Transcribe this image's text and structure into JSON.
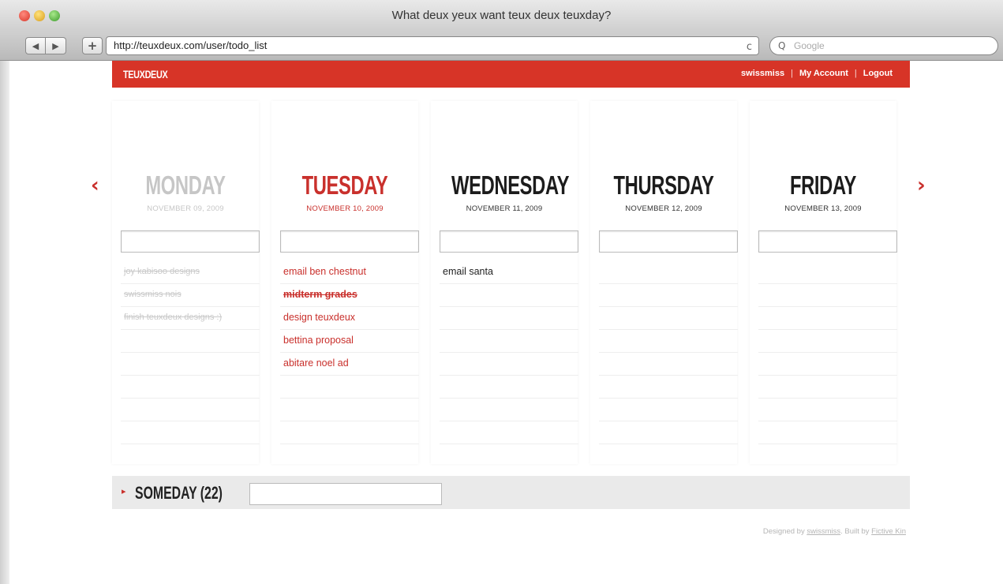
{
  "window": {
    "title": "What deux yeux want teux deux teuxday?"
  },
  "toolbar": {
    "back_icon": "◀",
    "forward_icon": "▶",
    "add_icon": "+",
    "url": "http://teuxdeux.com/user/todo_list",
    "reload_icon": "c",
    "search_icon": "Q",
    "search_placeholder": "Google"
  },
  "app": {
    "logo": "TEUXDEUX",
    "user_nav": {
      "username": "swissmiss",
      "separator": "|",
      "account": "My Account",
      "logout": "Logout"
    },
    "prev_icon": "‹",
    "next_icon": "›",
    "days": [
      {
        "name": "MONDAY",
        "date": "NOVEMBER 09, 2009",
        "state": "past",
        "todos": [
          "joy kabisoo designs",
          "swissmiss nois",
          "finish teuxdeux designs :)"
        ]
      },
      {
        "name": "TUESDAY",
        "date": "NOVEMBER 10, 2009",
        "state": "today",
        "todos": [
          "email ben chestnut",
          "midterm grades",
          "design teuxdeux",
          "bettina proposal",
          "abitare noel ad"
        ]
      },
      {
        "name": "WEDNESDAY",
        "date": "NOVEMBER 11, 2009",
        "state": "future",
        "todos": [
          "email santa"
        ]
      },
      {
        "name": "THURSDAY",
        "date": "NOVEMBER 12, 2009",
        "state": "future",
        "todos": []
      },
      {
        "name": "FRIDAY",
        "date": "NOVEMBER 13, 2009",
        "state": "future",
        "todos": []
      }
    ],
    "someday": {
      "arrow_icon": "▸",
      "label": "SOMEDAY (22)"
    },
    "footer": {
      "designed_prefix": "Designed by",
      "designer": "swissmiss",
      "built_prefix": "Built by",
      "builder": "Fictive Kin"
    }
  },
  "colors": {
    "brand_red": "#d73427",
    "today_red": "#c9302c"
  }
}
